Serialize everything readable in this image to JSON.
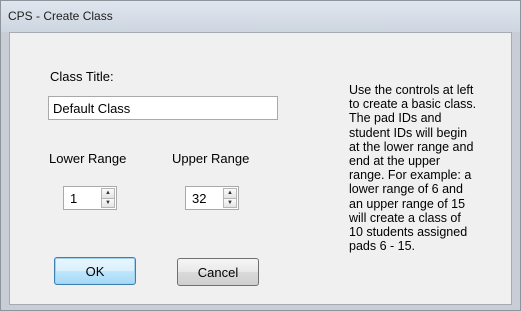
{
  "window": {
    "title": "CPS - Create Class"
  },
  "form": {
    "class_title_label": "Class Title:",
    "class_title_value": "Default Class",
    "lower_range_label": "Lower Range",
    "lower_range_value": "1",
    "upper_range_label": "Upper Range",
    "upper_range_value": "32",
    "ok_label": "OK",
    "cancel_label": "Cancel"
  },
  "help_text": "Use the controls at left\nto create a basic class.\nThe pad IDs and\nstudent IDs will begin\nat the lower range and\nend at the upper\nrange. For example: a\nlower range of 6 and\nan upper range of 15\nwill create a class of\n10 students assigned\npads 6 - 15.",
  "icons": {
    "spin_up": "spin-up-arrow",
    "spin_down": "spin-down-arrow"
  },
  "colors": {
    "default_button_border": "#3c7fb1",
    "client_background": "#f0f0f0"
  }
}
